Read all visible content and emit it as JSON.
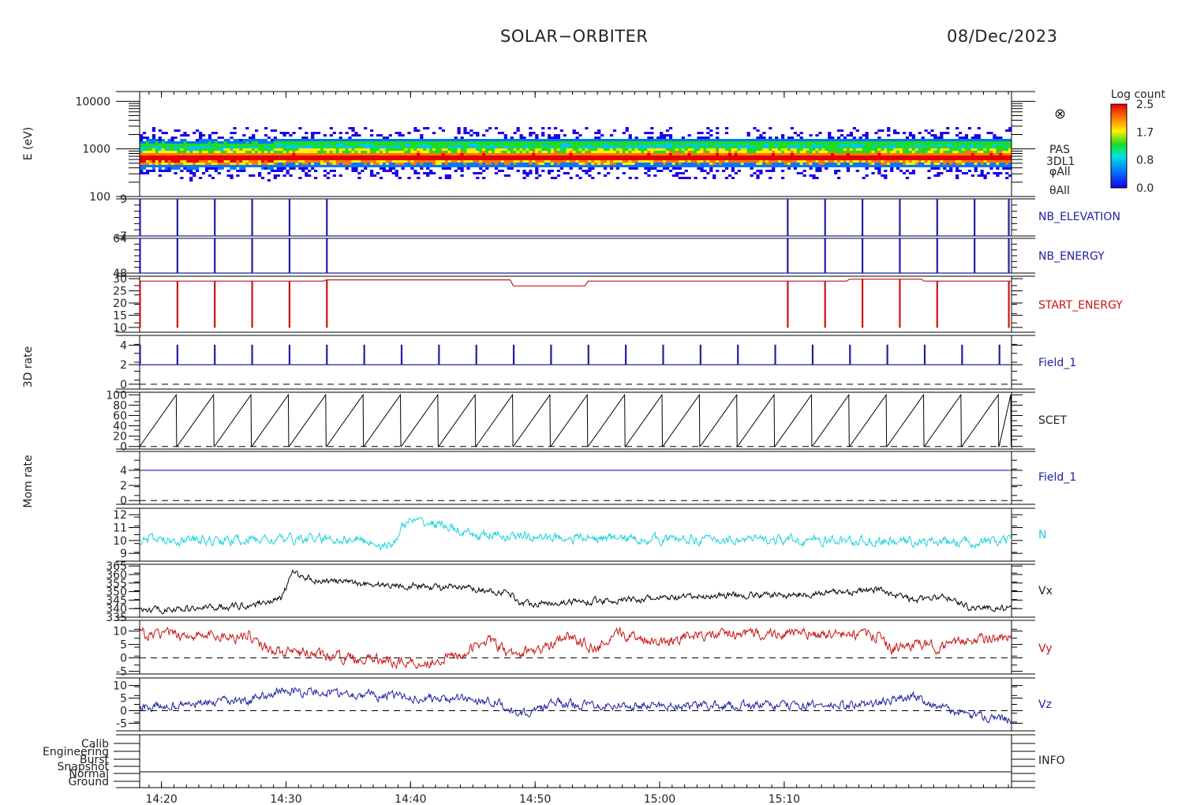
{
  "header": {
    "title": "SOLAR−ORBITER",
    "date": "08/Dec/2023"
  },
  "colors": {
    "blue": "#1f1fa0",
    "red": "#c81414",
    "cyan": "#19d2dc",
    "black": "#000000"
  },
  "chart_data": {
    "type": "line",
    "x_axis": {
      "unit": "UT (HH:MM)",
      "range": [
        "14:18:15",
        "15:18:00"
      ],
      "ticks": [
        {
          "t": "14:20",
          "m": 1.75
        },
        {
          "t": "14:30",
          "m": 11.75
        },
        {
          "t": "14:40",
          "m": 21.75
        },
        {
          "t": "14:50",
          "m": 31.75
        },
        {
          "t": "15:00",
          "m": 41.75
        },
        {
          "t": "15:10",
          "m": 51.75
        }
      ]
    },
    "panels": [
      {
        "id": "spectrogram",
        "type": "heatmap",
        "ylabel": "E (eV)",
        "yscale": "log",
        "ylim": [
          100,
          16000
        ],
        "yticks": [
          {
            "v": 10000,
            "t": "10000"
          },
          {
            "v": 1000,
            "t": "1000"
          },
          {
            "v": 100,
            "t": "100"
          }
        ],
        "right_labels": [
          "PAS",
          "3DL1",
          "φAll",
          "θAll"
        ],
        "marker": "⊗",
        "bands": [
          {
            "e_low": 300,
            "e_high": 3000,
            "peak_e": 650
          }
        ],
        "colorbar": {
          "title": "Log count",
          "ticks": [
            "2.5",
            "1.7",
            "0.8",
            "0.0"
          ],
          "range": [
            0,
            2.5
          ]
        }
      },
      {
        "id": "nb_elevation",
        "type": "line",
        "label": "NB_ELEVATION",
        "color": "#1f1fa0",
        "ylim": [
          7,
          9
        ],
        "yticks": [
          {
            "v": 9,
            "t": "9"
          },
          {
            "v": 7,
            "t": "7"
          }
        ],
        "base": 7,
        "spike": 9,
        "spike_minutes": [
          0,
          3,
          6,
          9,
          12,
          15,
          52,
          55,
          58,
          61,
          64,
          67,
          69.75
        ]
      },
      {
        "id": "nb_energy",
        "type": "line",
        "label": "NB_ENERGY",
        "color": "#1f1fa0",
        "ylim": [
          48,
          64
        ],
        "yticks": [
          {
            "v": 64,
            "t": "64"
          },
          {
            "v": 48,
            "t": "48"
          }
        ],
        "base": 48,
        "spike": 64,
        "spike_minutes": [
          0,
          3,
          6,
          9,
          12,
          15,
          52,
          55,
          58,
          61,
          64,
          67,
          69.75
        ]
      },
      {
        "id": "start_energy",
        "type": "line",
        "label": "START_ENERGY",
        "color": "#c81414",
        "ylim": [
          8,
          31
        ],
        "yticks": [
          {
            "v": 30,
            "t": "30"
          },
          {
            "v": 25,
            "t": "25"
          },
          {
            "v": 20,
            "t": "20"
          },
          {
            "v": 15,
            "t": "15"
          },
          {
            "v": 10,
            "t": "10"
          }
        ],
        "base": 29,
        "dip": 10,
        "dip_minutes": [
          0,
          3,
          6,
          9,
          12,
          15,
          52,
          55,
          58,
          61,
          64,
          69.75
        ],
        "steps": [
          {
            "from": 15,
            "to": 30,
            "v": 29.5
          },
          {
            "from": 30,
            "to": 36,
            "v": 27
          },
          {
            "from": 36,
            "to": 57,
            "v": 29
          },
          {
            "from": 57,
            "to": 63,
            "v": 29.8
          },
          {
            "from": 63,
            "to": 70,
            "v": 29
          }
        ]
      },
      {
        "id": "field1_3d",
        "type": "line",
        "label": "Field_1",
        "ylabel": "3D rate",
        "color": "#1f1fa0",
        "ylim": [
          -0.5,
          5
        ],
        "yticks": [
          {
            "v": 4,
            "t": "4"
          },
          {
            "v": 2,
            "t": "2"
          },
          {
            "v": 0,
            "t": "0"
          }
        ],
        "base": 2,
        "spike": 4,
        "spike_period_min": 3,
        "zero_dashed": true
      },
      {
        "id": "scet",
        "type": "line",
        "label": "SCET",
        "color": "#000000",
        "ylim": [
          -5,
          105
        ],
        "yticks": [
          {
            "v": 100,
            "t": "100"
          },
          {
            "v": 80,
            "t": "80"
          },
          {
            "v": 60,
            "t": "60"
          },
          {
            "v": 40,
            "t": "40"
          },
          {
            "v": 20,
            "t": "20"
          },
          {
            "v": 0,
            "t": "0"
          }
        ],
        "sawtooth_period_min": 3,
        "min": 0,
        "max": 100
      },
      {
        "id": "field1_mom",
        "type": "line",
        "label": "Field_1",
        "ylabel": "Mom rate",
        "color": "#1f1fa0",
        "ylim": [
          -0.5,
          6.5
        ],
        "yticks": [
          {
            "v": 4,
            "t": "4"
          },
          {
            "v": 2,
            "t": "2"
          },
          {
            "v": 0,
            "t": "0"
          }
        ],
        "constant": 4,
        "zero_dashed": true
      },
      {
        "id": "N",
        "type": "line",
        "label": "N",
        "color": "#19d2dc",
        "ylim": [
          8.4,
          12.5
        ],
        "yticks": [
          {
            "v": 12,
            "t": "12"
          },
          {
            "v": 11,
            "t": "11"
          },
          {
            "v": 10,
            "t": "10"
          },
          {
            "v": 9,
            "t": "9"
          }
        ],
        "baseline": [
          [
            0,
            10.1
          ],
          [
            8,
            10.0
          ],
          [
            12,
            10.1
          ],
          [
            20,
            10.1
          ],
          [
            23,
            9.5
          ],
          [
            24.5,
            11.5
          ],
          [
            28,
            11.2
          ],
          [
            30,
            10.4
          ],
          [
            40,
            10.2
          ],
          [
            50,
            10.1
          ],
          [
            60,
            10.0
          ],
          [
            70,
            9.9
          ]
        ],
        "noise": 0.3
      },
      {
        "id": "Vx",
        "type": "line",
        "label": "Vx",
        "color": "#000000",
        "ylim": [
          335,
          366
        ],
        "yticks": [
          {
            "v": 365,
            "t": "365"
          },
          {
            "v": 360,
            "t": "360"
          },
          {
            "v": 355,
            "t": "355"
          },
          {
            "v": 350,
            "t": "350"
          },
          {
            "v": 345,
            "t": "345"
          },
          {
            "v": 340,
            "t": "340"
          },
          {
            "v": 335,
            "t": "335"
          }
        ],
        "baseline": [
          [
            0,
            339
          ],
          [
            5,
            340
          ],
          [
            10,
            342
          ],
          [
            13,
            346
          ],
          [
            14,
            361
          ],
          [
            16,
            357
          ],
          [
            22,
            354
          ],
          [
            30,
            352
          ],
          [
            34,
            349
          ],
          [
            35,
            343
          ],
          [
            40,
            344
          ],
          [
            48,
            346
          ],
          [
            54,
            348
          ],
          [
            60,
            348
          ],
          [
            65,
            350
          ],
          [
            68,
            351
          ],
          [
            71,
            345
          ],
          [
            74,
            347
          ],
          [
            76,
            341
          ],
          [
            80,
            340
          ]
        ],
        "noise": 1.5
      },
      {
        "id": "Vy",
        "type": "line",
        "label": "Vy",
        "color": "#c81414",
        "ylim": [
          -6,
          14
        ],
        "yticks": [
          {
            "v": 10,
            "t": "10"
          },
          {
            "v": 5,
            "t": "5"
          },
          {
            "v": 0,
            "t": "0"
          },
          {
            "v": -5,
            "t": "-5"
          }
        ],
        "baseline": [
          [
            0,
            9
          ],
          [
            9,
            8
          ],
          [
            10,
            9
          ],
          [
            11,
            5
          ],
          [
            13,
            2
          ],
          [
            18,
            0.5
          ],
          [
            26,
            -2
          ],
          [
            30,
            2
          ],
          [
            32,
            7
          ],
          [
            34,
            1
          ],
          [
            37,
            3
          ],
          [
            39,
            9
          ],
          [
            42,
            3
          ],
          [
            44,
            9
          ],
          [
            48,
            6
          ],
          [
            50,
            8
          ],
          [
            56,
            9
          ],
          [
            62,
            9
          ],
          [
            68,
            8
          ],
          [
            69,
            3
          ],
          [
            71,
            5
          ],
          [
            74,
            4
          ],
          [
            76,
            7
          ],
          [
            80,
            7
          ]
        ],
        "noise": 1.6,
        "zero_dashed": true
      },
      {
        "id": "Vz",
        "type": "line",
        "label": "Vz",
        "color": "#1f1fa0",
        "ylim": [
          -8,
          13
        ],
        "yticks": [
          {
            "v": 10,
            "t": "10"
          },
          {
            "v": 5,
            "t": "5"
          },
          {
            "v": 0,
            "t": "0"
          },
          {
            "v": -5,
            "t": "-5"
          }
        ],
        "baseline": [
          [
            0,
            1
          ],
          [
            6,
            3
          ],
          [
            10,
            4
          ],
          [
            13,
            8
          ],
          [
            18,
            7
          ],
          [
            26,
            5
          ],
          [
            33,
            4
          ],
          [
            34,
            -1
          ],
          [
            36,
            -1
          ],
          [
            38,
            3
          ],
          [
            45,
            2
          ],
          [
            55,
            2
          ],
          [
            65,
            2
          ],
          [
            68,
            3
          ],
          [
            71,
            6
          ],
          [
            73,
            2
          ],
          [
            76,
            -2
          ],
          [
            80,
            -3
          ]
        ],
        "noise": 1.4,
        "zero_dashed": true
      },
      {
        "id": "info",
        "type": "table",
        "label": "INFO",
        "ylabels": [
          "Calib",
          "Engineering",
          "Burst",
          "Snapshot",
          "Normal",
          "Ground"
        ],
        "active_row": "Normal"
      }
    ]
  }
}
